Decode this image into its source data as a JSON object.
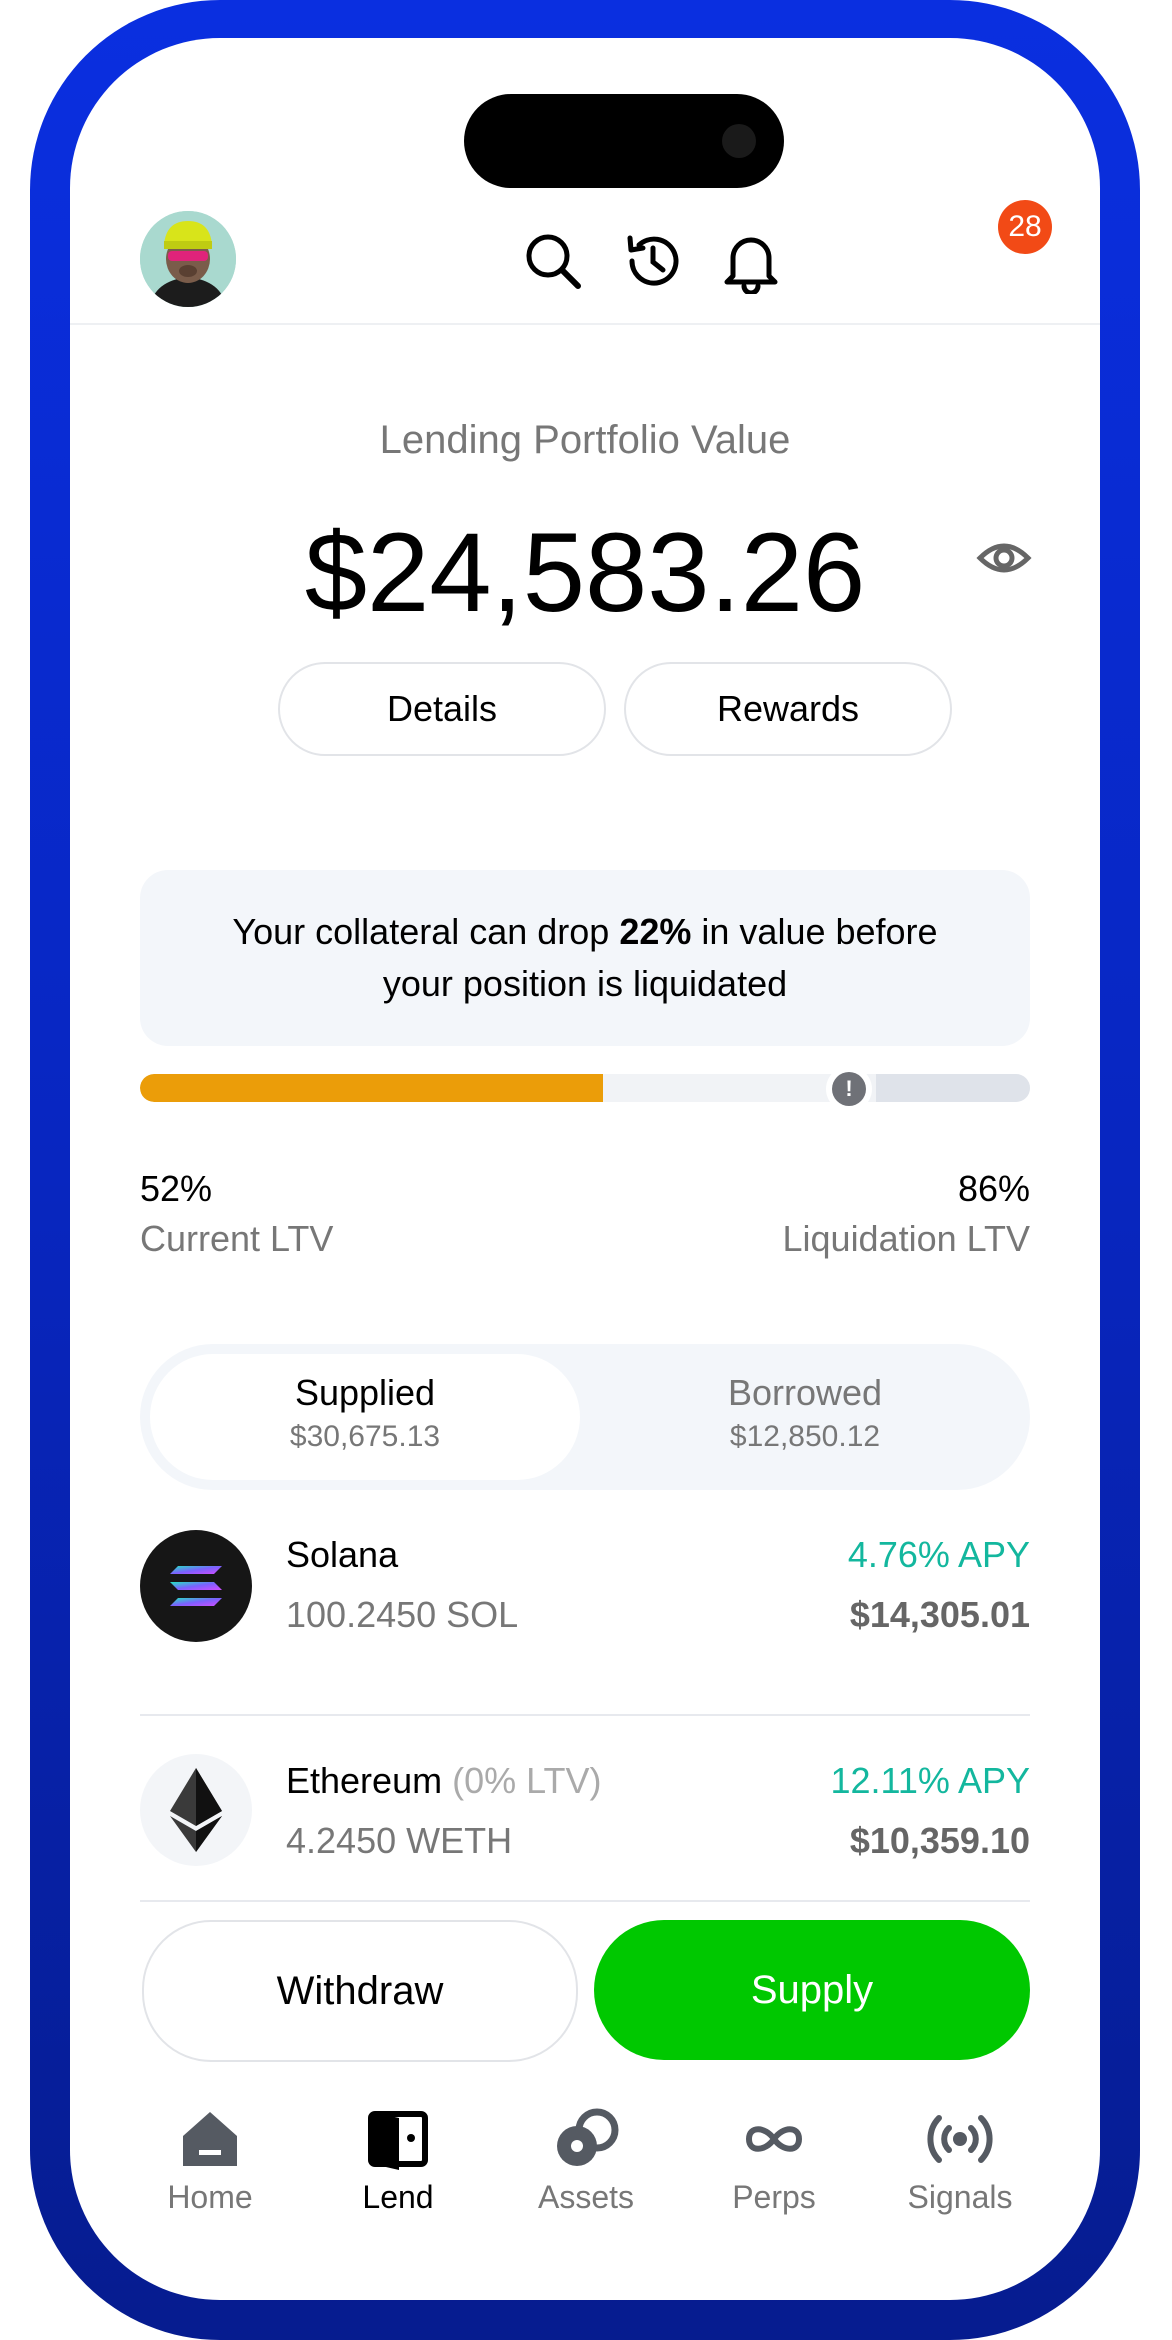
{
  "header": {
    "notification_count": "28",
    "icons": [
      "avatar",
      "search-icon",
      "history-icon",
      "bell-icon"
    ]
  },
  "portfolio": {
    "label": "Lending Portfolio Value",
    "value": "$24,583.26",
    "details_label": "Details",
    "rewards_label": "Rewards"
  },
  "notice": {
    "prefix": "Your collateral can drop ",
    "highlight": "22%",
    "suffix_line1": " in value before",
    "line2": "your position is liquidated"
  },
  "ltv": {
    "current_fraction": 0.52,
    "current_value": "52%",
    "current_label": "Current LTV",
    "liquidation_value": "86%",
    "liquidation_label": "Liquidation LTV",
    "marker_glyph": "!",
    "bar_color": "#eb9d09"
  },
  "tabs": {
    "supplied_label": "Supplied",
    "supplied_amount": "$30,675.13",
    "borrowed_label": "Borrowed",
    "borrowed_amount": "$12,850.12"
  },
  "assets": [
    {
      "name": "Solana",
      "note": "",
      "amount": "100.2450 SOL",
      "apy": "4.76% APY",
      "usd": "$14,305.01",
      "icon": "solana-icon"
    },
    {
      "name": "Ethereum",
      "note": "(0% LTV)",
      "amount": "4.2450 WETH",
      "apy": "12.11% APY",
      "usd": "$10,359.10",
      "icon": "ethereum-icon"
    }
  ],
  "actions": {
    "withdraw_label": "Withdraw",
    "supply_label": "Supply",
    "supply_color": "#00c800"
  },
  "nav": {
    "items": [
      {
        "label": "Home",
        "icon": "home-icon"
      },
      {
        "label": "Lend",
        "icon": "lend-icon"
      },
      {
        "label": "Assets",
        "icon": "assets-icon"
      },
      {
        "label": "Perps",
        "icon": "infinity-icon"
      },
      {
        "label": "Signals",
        "icon": "signal-icon"
      }
    ],
    "active": "Lend"
  },
  "colors": {
    "frame": "#0a2fe0",
    "apy_green": "#13b79e",
    "badge": "#f24a16"
  }
}
